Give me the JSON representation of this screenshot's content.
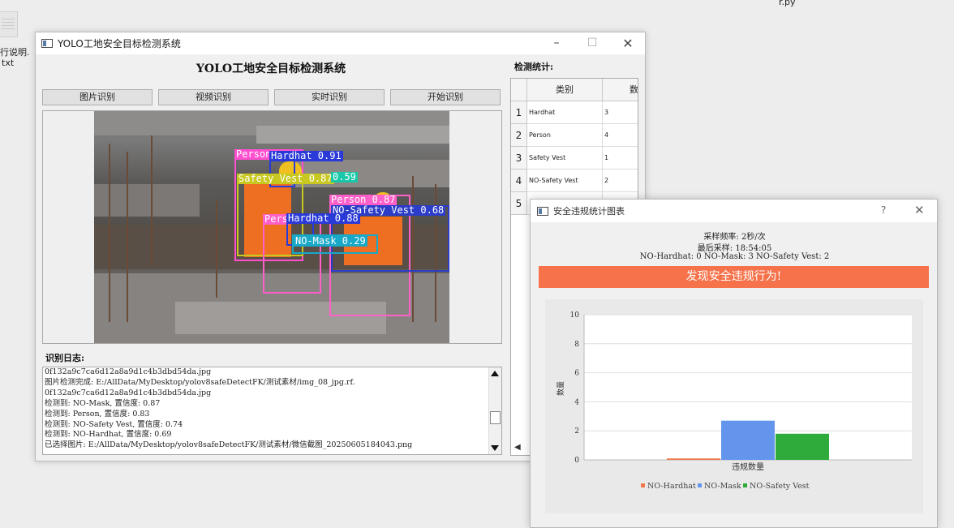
{
  "desktop": {
    "file_label_line1": "行说明.",
    "file_label_line2": "txt",
    "py_label": "r.py"
  },
  "main_window": {
    "title": "YOLO工地安全目标检测系统",
    "heading": "YOLO工地安全目标检测系统",
    "buttons": [
      "图片识别",
      "视频识别",
      "实时识别",
      "开始识别"
    ],
    "detections": [
      {
        "label": "Person",
        "color": "#ff4fd0"
      },
      {
        "label": "Hardhat 0.91",
        "color": "#2a3ad8"
      },
      {
        "label": "Safety Vest 0.87",
        "color": "#c8c820"
      },
      {
        "label": "0.59",
        "color": "#18c8a8"
      },
      {
        "label": "Person 0.87",
        "color": "#ff5fc8"
      },
      {
        "label": "NO-Safety Vest 0.68",
        "color": "#2b3dc8"
      },
      {
        "label": "Pers",
        "color": "#ff5fc8"
      },
      {
        "label": "Hardhat 0.88",
        "color": "#2a3ad8"
      },
      {
        "label": "NO-Mask 0.29",
        "color": "#18a8c8"
      }
    ],
    "log_title": "识别日志:",
    "log_lines": [
      "0f132a9c7ca6d12a8a9d1c4b3dbd54da.jpg",
      "图片检测完成: E:/AllData/MyDesktop/yolov8safeDetectFK/测试素材/img_08_jpg.rf.",
      "0f132a9c7ca6d12a8a9d1c4b3dbd54da.jpg",
      "检测到: NO-Mask, 置信度: 0.87",
      "检测到: Person, 置信度: 0.83",
      "检测到: NO-Safety Vest, 置信度: 0.74",
      "检测到: NO-Hardhat, 置信度: 0.69",
      "已选择图片: E:/AllData/MyDesktop/yolov8safeDetectFK/测试素材/微信截图_20250605184043.png"
    ],
    "stats_title": "检测统计:",
    "stats_headers": [
      "类别",
      "数"
    ],
    "stats_rows": [
      {
        "num": "1",
        "category": "Hardhat",
        "count": "3"
      },
      {
        "num": "2",
        "category": "Person",
        "count": "4"
      },
      {
        "num": "3",
        "category": "Safety Vest",
        "count": "1"
      },
      {
        "num": "4",
        "category": "NO-Safety Vest",
        "count": "2"
      },
      {
        "num": "5",
        "category": "",
        "count": ""
      }
    ]
  },
  "dialog": {
    "title": "安全违规统计图表",
    "help": "?",
    "sample_rate": "采样频率: 2秒/次",
    "last_sample": "最后采样: 18:54:05",
    "summary": "NO-Hardhat: 0  NO-Mask: 3  NO-Safety Vest: 2",
    "alert": "发现安全违规行为!"
  },
  "chart_data": {
    "type": "bar",
    "categories": [
      "违规数量"
    ],
    "series": [
      {
        "name": "NO-Hardhat",
        "values": [
          0.1
        ],
        "color": "#f0764c"
      },
      {
        "name": "NO-Mask",
        "values": [
          2.7
        ],
        "color": "#6495ed"
      },
      {
        "name": "NO-Safety Vest",
        "values": [
          1.8
        ],
        "color": "#2eab3a"
      }
    ],
    "ylabel": "数量",
    "xlabel": "违规数量",
    "ylim": [
      0,
      10
    ],
    "yticks": [
      "0",
      "2",
      "4",
      "6",
      "8",
      "10"
    ],
    "legend": "bottom",
    "grid": true
  }
}
